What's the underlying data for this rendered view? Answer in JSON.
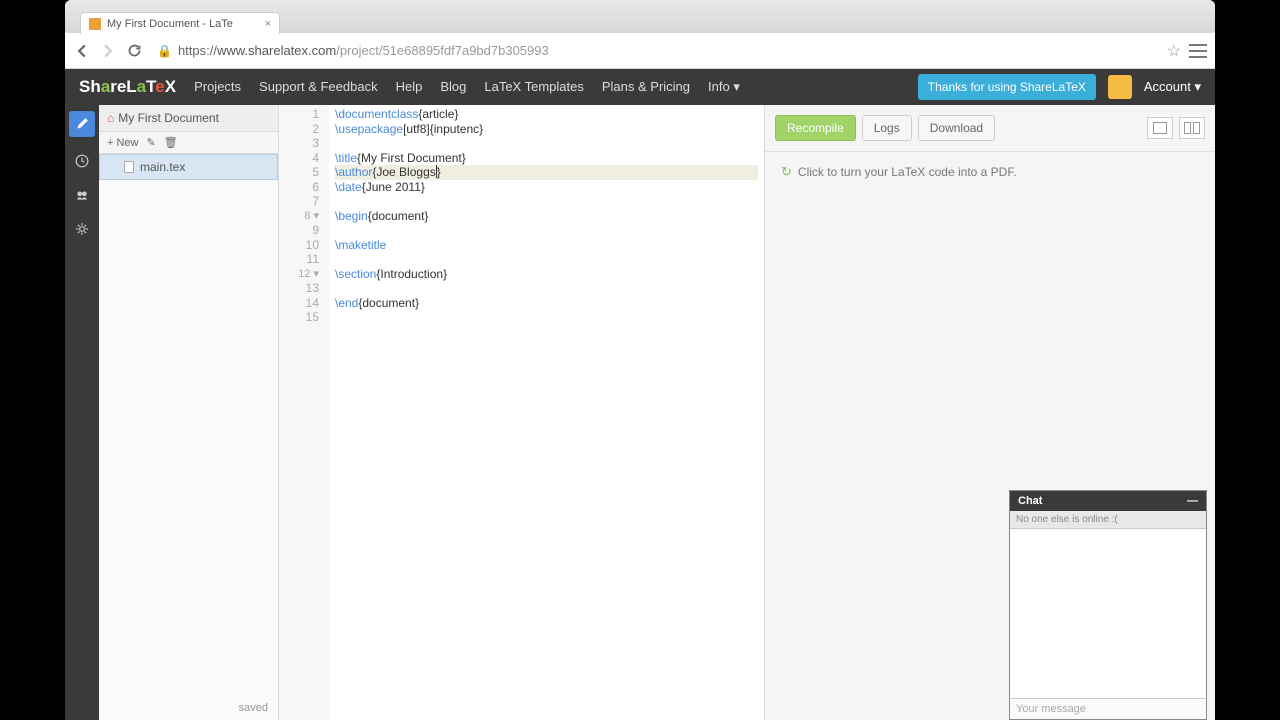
{
  "browser": {
    "tab_title": "My First Document - LaTe",
    "url_scheme": "https://",
    "url_host": "www.sharelatex.com",
    "url_path": "/project/51e68895fdf7a9bd7b305993"
  },
  "navbar": {
    "brand_prefix": "Sh",
    "brand_a": "a",
    "brand_mid": "reL",
    "brand_a2": "a",
    "brand_t": "T",
    "brand_e": "e",
    "brand_x": "X",
    "links": [
      "Projects",
      "Support & Feedback",
      "Help",
      "Blog",
      "LaTeX Templates",
      "Plans & Pricing",
      "Info"
    ],
    "thanks": "Thanks for using ShareLaTeX",
    "account": "Account"
  },
  "filetree": {
    "project_name": "My First Document",
    "new_label": "New",
    "file": "main.tex",
    "saved": "saved"
  },
  "editor": {
    "lines": [
      {
        "n": "1",
        "pre": "",
        "cmd": "\\documentclass",
        "post": "{article}"
      },
      {
        "n": "2",
        "pre": "",
        "cmd": "\\usepackage",
        "post": "[utf8]{inputenc}"
      },
      {
        "n": "3",
        "pre": "",
        "cmd": "",
        "post": ""
      },
      {
        "n": "4",
        "pre": "",
        "cmd": "\\title",
        "post": "{My First Document}"
      },
      {
        "n": "5",
        "pre": "",
        "cmd": "\\author",
        "post": "{Joe Bloggs}",
        "hl": true,
        "cursor": true
      },
      {
        "n": "6",
        "pre": "",
        "cmd": "\\date",
        "post": "{June 2011}"
      },
      {
        "n": "7",
        "pre": "",
        "cmd": "",
        "post": ""
      },
      {
        "n": "8",
        "pre": "",
        "cmd": "\\begin",
        "post": "{document}",
        "fold": true
      },
      {
        "n": "9",
        "pre": "",
        "cmd": "",
        "post": ""
      },
      {
        "n": "10",
        "pre": "",
        "cmd": "\\maketitle",
        "post": ""
      },
      {
        "n": "11",
        "pre": "",
        "cmd": "",
        "post": ""
      },
      {
        "n": "12",
        "pre": "",
        "cmd": "\\section",
        "post": "{Introduction}",
        "fold": true
      },
      {
        "n": "13",
        "pre": "",
        "cmd": "",
        "post": ""
      },
      {
        "n": "14",
        "pre": "",
        "cmd": "\\end",
        "post": "{document}"
      },
      {
        "n": "15",
        "pre": "",
        "cmd": "",
        "post": ""
      }
    ]
  },
  "preview": {
    "recompile": "Recompile",
    "logs": "Logs",
    "download": "Download",
    "hint": "Click to turn your LaTeX code into a PDF."
  },
  "chat": {
    "title": "Chat",
    "status": "No one else is online :(",
    "placeholder": "Your message"
  }
}
